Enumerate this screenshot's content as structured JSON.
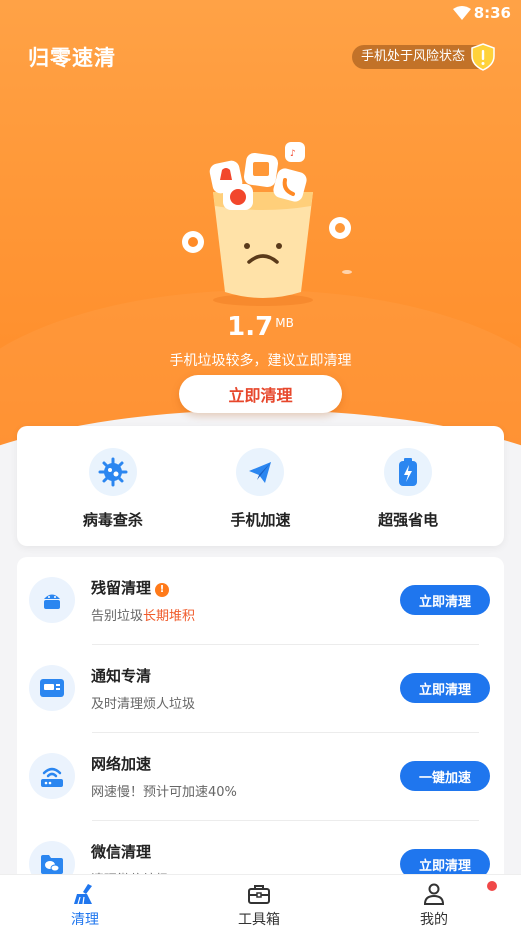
{
  "status_bar": {
    "time": "8:36",
    "wifi_icon": "wifi-icon"
  },
  "header": {
    "app_title": "归零速清",
    "risk_badge": "手机处于风险状态",
    "risk_icon": "shield-warning-icon"
  },
  "hero": {
    "junk_size": "1.7",
    "junk_unit": "MB",
    "hint": "手机垃圾较多，建议立即清理",
    "clean_button": "立即清理",
    "illustration": "trash-bucket-illustration"
  },
  "quick_actions": [
    {
      "label": "病毒查杀",
      "icon": "virus-gear-icon"
    },
    {
      "label": "手机加速",
      "icon": "paper-plane-icon"
    },
    {
      "label": "超强省电",
      "icon": "battery-icon"
    }
  ],
  "tasks": [
    {
      "title": "残留清理",
      "subtitle": "告别垃圾",
      "subtitle_emphasis": "长期堆积",
      "button": "立即清理",
      "icon": "android-icon",
      "warning": "!"
    },
    {
      "title": "通知专清",
      "subtitle": "及时清理烦人垃圾",
      "subtitle_emphasis": "",
      "button": "立即清理",
      "icon": "notification-icon",
      "warning": ""
    },
    {
      "title": "网络加速",
      "subtitle": "网速慢！预计可加速40%",
      "subtitle_emphasis": "",
      "button": "一键加速",
      "icon": "router-wifi-icon",
      "warning": ""
    },
    {
      "title": "微信清理",
      "subtitle": "清理微信垃圾",
      "subtitle_emphasis": "",
      "button": "立即清理",
      "icon": "wechat-folder-icon",
      "warning": ""
    }
  ],
  "tabbar": [
    {
      "label": "清理",
      "icon": "broom-icon",
      "active": true
    },
    {
      "label": "工具箱",
      "icon": "toolbox-icon",
      "active": false
    },
    {
      "label": "我的",
      "icon": "user-icon",
      "active": false
    }
  ],
  "colors": {
    "accent_orange": "#ff9838",
    "primary_blue": "#1f76ee",
    "emphasis_red": "#f05a2a"
  }
}
